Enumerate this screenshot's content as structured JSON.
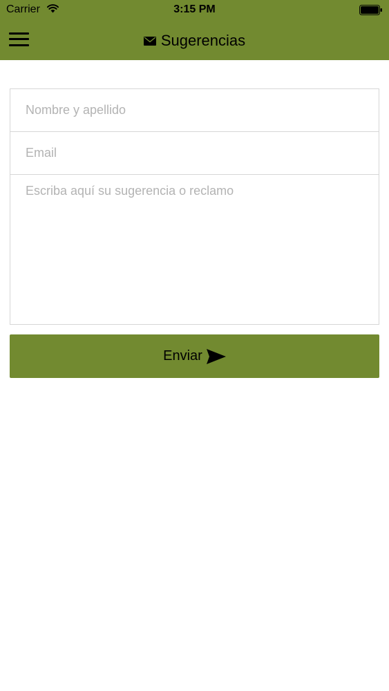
{
  "status_bar": {
    "carrier": "Carrier",
    "time": "3:15 PM",
    "wifi_icon": "wifi-icon",
    "battery_icon": "battery-icon"
  },
  "nav_bar": {
    "title": "Sugerencias",
    "title_icon": "envelope-icon",
    "menu_icon": "hamburger-menu-icon"
  },
  "form": {
    "name_placeholder": "Nombre y apellido",
    "name_value": "",
    "email_placeholder": "Email",
    "email_value": "",
    "message_placeholder": "Escriba aquí su sugerencia o reclamo",
    "message_value": ""
  },
  "send_button": {
    "label": "Enviar",
    "icon": "send-arrow-icon"
  },
  "colors": {
    "accent": "#728a30",
    "background": "#ffffff",
    "border": "#d6d6d6",
    "placeholder": "#b3b3b3"
  }
}
